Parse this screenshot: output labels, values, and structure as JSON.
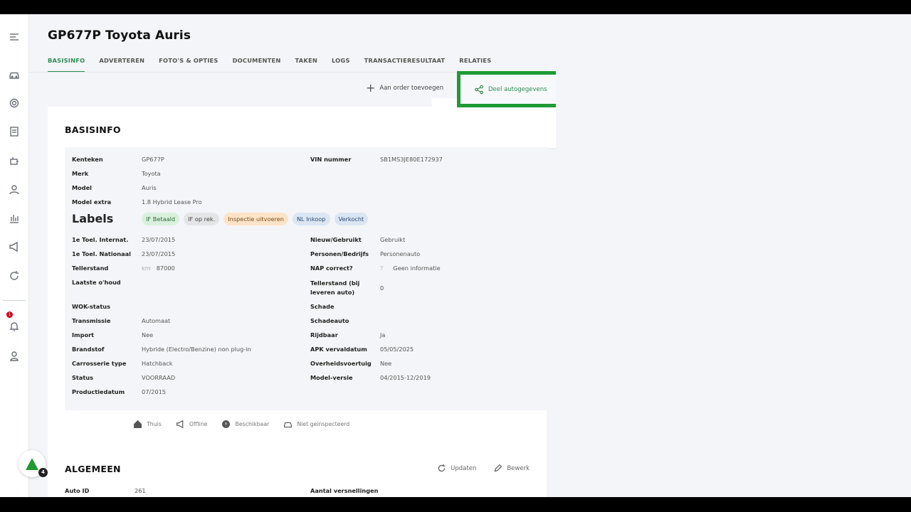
{
  "page": {
    "title": "GP677P Toyota Auris"
  },
  "tabs": [
    "BASISINFO",
    "ADVERTEREN",
    "FOTO'S & OPTIES",
    "DOCUMENTEN",
    "TAKEN",
    "LOGS",
    "TRANSACTIERESULTAAT",
    "RELATIES"
  ],
  "actions": {
    "add_to_order": "Aan order toevoegen",
    "share": "Deel autogegevens"
  },
  "basisinfo": {
    "title": "BASISINFO",
    "left_top": [
      {
        "label": "Kenteken",
        "value": "GP677P"
      },
      {
        "label": "Merk",
        "value": "Toyota"
      },
      {
        "label": "Model",
        "value": "Auris"
      },
      {
        "label": "Model extra",
        "value": "1.8 Hybrid Lease Pro"
      }
    ],
    "vin": {
      "label": "VIN nummer",
      "value": "SB1MS3JE80E172937"
    },
    "labels_label": "Labels",
    "chips": [
      "IF Betaald",
      "IF op rek.",
      "Inspectie uitvoeren",
      "NL Inkoop",
      "Verkocht"
    ],
    "left_bottom": [
      {
        "label": "1e Toel. Internat.",
        "value": "23/07/2015"
      },
      {
        "label": "1e Toel. Nationaal",
        "value": "23/07/2015"
      },
      {
        "label": "Tellerstand",
        "unit": "km",
        "value": "87000"
      },
      {
        "label": "Laatste o'houd",
        "value": ""
      },
      {
        "label": "WOK-status",
        "value": ""
      },
      {
        "label": "Transmissie",
        "value": "Automaat"
      },
      {
        "label": "Import",
        "value": "Nee"
      },
      {
        "label": "Brandstof",
        "value": "Hybride (Electro/Benzine) non plug-in"
      },
      {
        "label": "Carrosserie type",
        "value": "Hatchback"
      },
      {
        "label": "Status",
        "value": "VOORRAAD"
      },
      {
        "label": "Productiedatum",
        "value": "07/2015"
      }
    ],
    "right_bottom": [
      {
        "label": "Nieuw/Gebruikt",
        "value": "Gebruikt"
      },
      {
        "label": "Personen/Bedrijfs",
        "value": "Personenauto"
      },
      {
        "label": "NAP correct?",
        "marker": "?",
        "value": "Geen informatie"
      },
      {
        "label": "Tellerstand (bij leveren auto)",
        "value": "0"
      },
      {
        "label": "Schade",
        "value": ""
      },
      {
        "label": "Schadeauto",
        "value": ""
      },
      {
        "label": "Rijdbaar",
        "value": "Ja"
      },
      {
        "label": "APK vervaldatum",
        "value": "05/05/2025"
      },
      {
        "label": "Overheidsvoertuig",
        "value": "Nee"
      },
      {
        "label": "Model-versie",
        "value": "04/2015-12/2019"
      }
    ]
  },
  "statusbar": [
    {
      "icon": "home-icon",
      "label": "Thuis"
    },
    {
      "icon": "megaphone-icon",
      "label": "Offline"
    },
    {
      "icon": "info-icon",
      "label": "Beschikbaar"
    },
    {
      "icon": "car-icon",
      "label": "Niet geinspecteerd"
    }
  ],
  "algemeen": {
    "title": "ALGEMEEN",
    "update": "Updaten",
    "edit": "Bewerk",
    "auto_id_label": "Auto ID",
    "auto_id_value": "261",
    "gears_label": "Aantal versnellingen"
  },
  "notifications": {
    "count": "1"
  },
  "fab": {
    "count": "4"
  },
  "colors": {
    "accent": "#2e8b57",
    "highlight": "#1f9a35",
    "badge": "#d0021b"
  }
}
